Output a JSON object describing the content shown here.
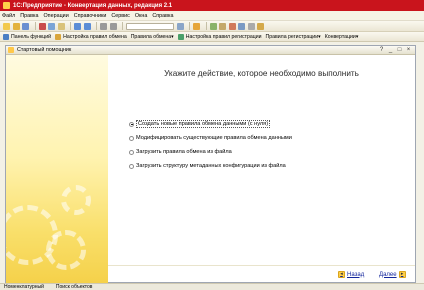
{
  "title": "1С:Предприятие - Конвертация данных, редакция 2.1",
  "menu": [
    "Файл",
    "Правка",
    "Операции",
    "Справочники",
    "Сервис",
    "Окна",
    "Справка"
  ],
  "toolbar2": [
    "Панель функций",
    "Настройка правил обмена",
    "Правила обмена",
    "Настройка правил регистрации",
    "Правила регистрации",
    "Конвертации"
  ],
  "window": {
    "title": "Стартовый помощник",
    "heading": "Укажите действие, которое необходимо выполнить",
    "options": [
      "Создать новые правила обмена данными (с нуля)",
      "Модифицировать существующие правила обмена данными",
      "Загрузить правила обмена из файла",
      "Загрузить структуру метаданных конфигурации из файла"
    ],
    "back_label": "Назад",
    "next_label": "Далее"
  },
  "status": [
    "Номенклатурный",
    "Поиск объектов"
  ]
}
